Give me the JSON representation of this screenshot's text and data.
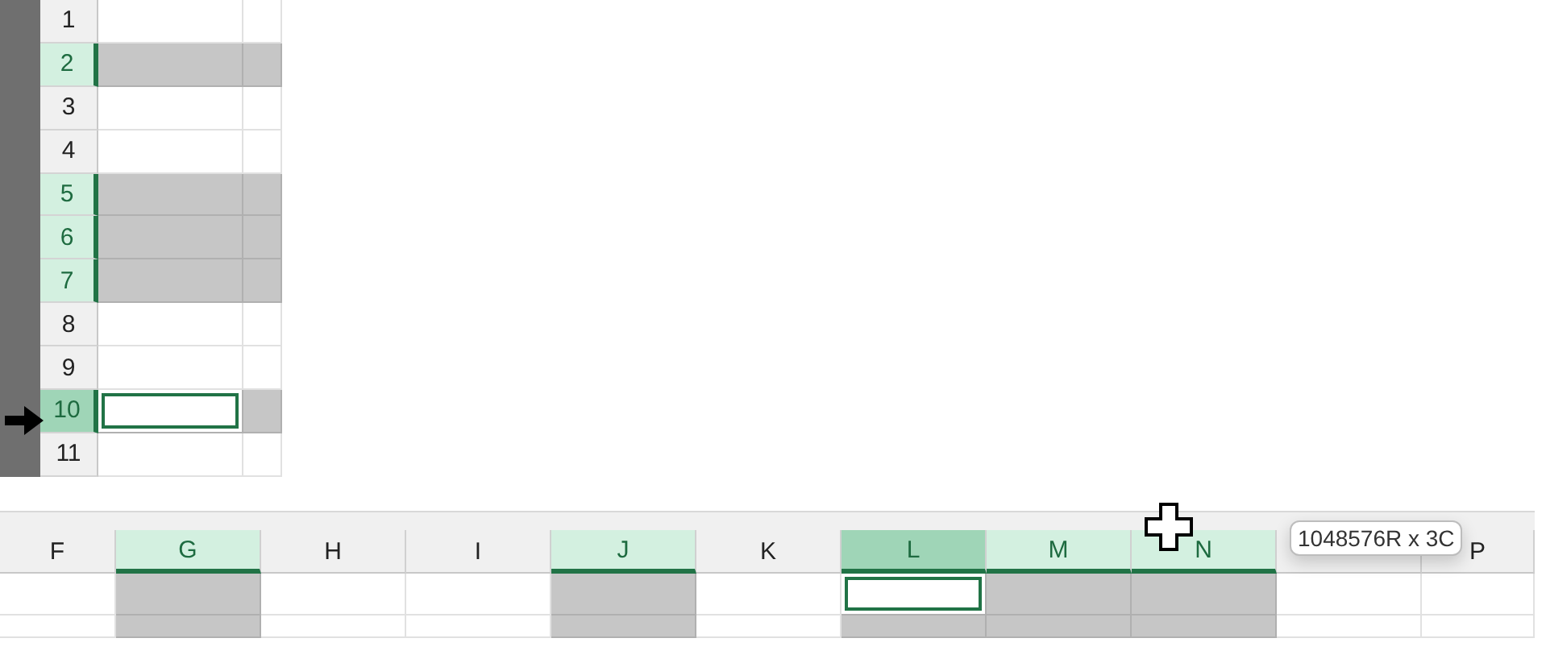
{
  "row_headers": [
    {
      "label": "1",
      "selected": false,
      "active": false
    },
    {
      "label": "2",
      "selected": true,
      "active": false
    },
    {
      "label": "3",
      "selected": false,
      "active": false
    },
    {
      "label": "4",
      "selected": false,
      "active": false
    },
    {
      "label": "5",
      "selected": true,
      "active": false
    },
    {
      "label": "6",
      "selected": true,
      "active": false
    },
    {
      "label": "7",
      "selected": true,
      "active": false
    },
    {
      "label": "8",
      "selected": false,
      "active": false
    },
    {
      "label": "9",
      "selected": false,
      "active": false
    },
    {
      "label": "10",
      "selected": true,
      "active": true
    },
    {
      "label": "11",
      "selected": false,
      "active": false
    }
  ],
  "column_headers": [
    {
      "label": "F",
      "selected": false,
      "active": false
    },
    {
      "label": "G",
      "selected": true,
      "active": false
    },
    {
      "label": "H",
      "selected": false,
      "active": false
    },
    {
      "label": "I",
      "selected": false,
      "active": false
    },
    {
      "label": "J",
      "selected": true,
      "active": false
    },
    {
      "label": "K",
      "selected": false,
      "active": false
    },
    {
      "label": "L",
      "selected": true,
      "active": true
    },
    {
      "label": "M",
      "selected": true,
      "active": false
    },
    {
      "label": "N",
      "selected": true,
      "active": false
    },
    {
      "selected": false,
      "active": false
    },
    {
      "label": "P",
      "selected": false,
      "active": false
    }
  ],
  "tooltip": "1048576R x 3C"
}
